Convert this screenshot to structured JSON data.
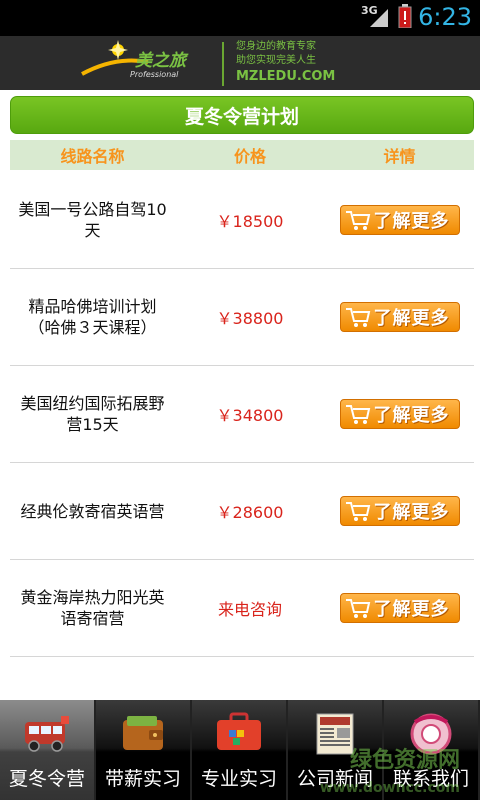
{
  "status_bar": {
    "network": "3G",
    "time": "6:23"
  },
  "header": {
    "brand": "美之旅",
    "brand_sub": "Professional",
    "slogan_line1": "您身边的教育专家",
    "slogan_line2": "助您实现完美人生",
    "site": "MZLEDU.COM"
  },
  "page": {
    "title": "夏冬令营计划",
    "columns": {
      "name": "线路名称",
      "price": "价格",
      "detail": "详情"
    },
    "rows": [
      {
        "name": "美国一号公路自驾10天",
        "price": "￥18500",
        "button": "了解更多"
      },
      {
        "name": "精品哈佛培训计划（哈佛３天课程）",
        "price": "￥38800",
        "button": "了解更多"
      },
      {
        "name": "美国纽约国际拓展野营15天",
        "price": "￥34800",
        "button": "了解更多"
      },
      {
        "name": "经典伦敦寄宿英语营",
        "price": "￥28600",
        "button": "了解更多"
      },
      {
        "name": "黄金海岸热力阳光英语寄宿营",
        "price": "来电咨询",
        "button": "了解更多"
      }
    ]
  },
  "tabs": [
    {
      "label": "夏冬令营",
      "icon": "bus-icon",
      "active": true
    },
    {
      "label": "带薪实习",
      "icon": "wallet-icon",
      "active": false
    },
    {
      "label": "专业实习",
      "icon": "briefcase-icon",
      "active": false
    },
    {
      "label": "公司新闻",
      "icon": "newspaper-icon",
      "active": false
    },
    {
      "label": "联系我们",
      "icon": "phone-icon",
      "active": false
    }
  ],
  "watermark": {
    "line1": "绿色资源网",
    "line2": "www.downcc.com"
  },
  "colors": {
    "accent_green": "#6ab81c",
    "header_orange": "#f7941d",
    "price_red": "#d9241c",
    "button_orange": "#f08a00"
  }
}
